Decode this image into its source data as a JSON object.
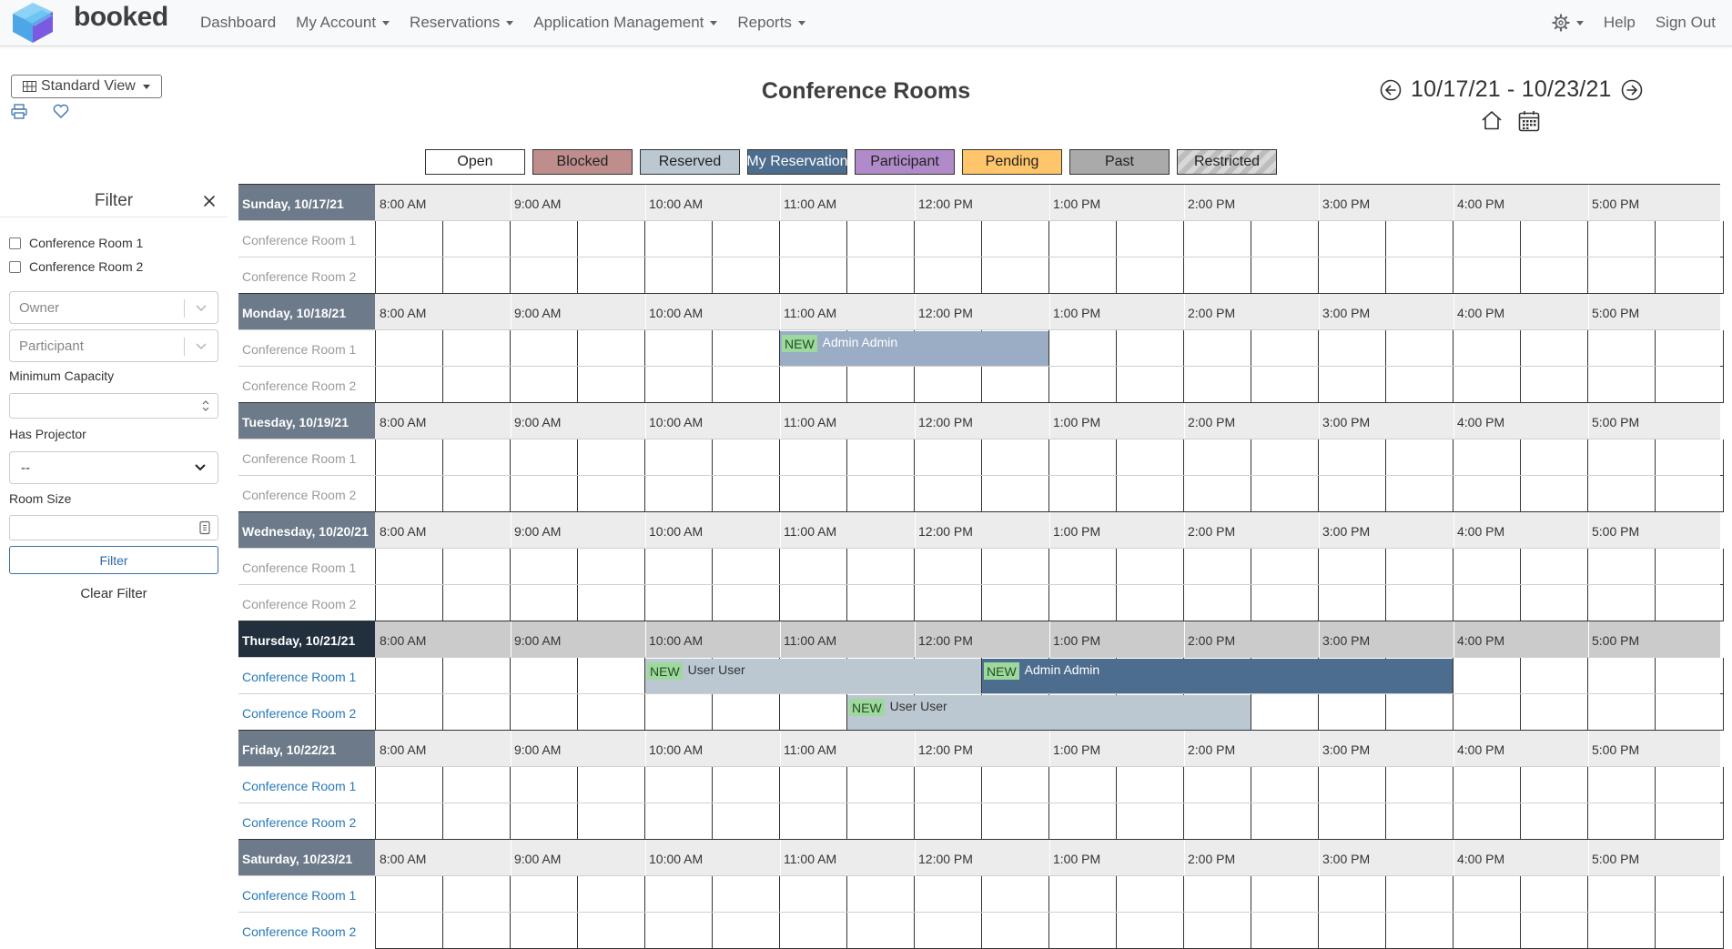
{
  "navbar": {
    "brand": "booked",
    "items": [
      "Dashboard",
      "My Account",
      "Reservations",
      "Application Management",
      "Reports"
    ],
    "right": [
      "Help",
      "Sign Out"
    ]
  },
  "toolbar": {
    "view_label": "Standard View",
    "title": "Conference Rooms",
    "date_range": "10/17/21 - 10/23/21"
  },
  "legend": [
    {
      "label": "Open",
      "bg": "#ffffff",
      "fg": "#222222"
    },
    {
      "label": "Blocked",
      "bg": "#c08d8d",
      "fg": "#222222"
    },
    {
      "label": "Reserved",
      "bg": "#bbc8d1",
      "fg": "#222222"
    },
    {
      "label": "My Reservation",
      "bg": "#4d6d8f",
      "fg": "#ffffff"
    },
    {
      "label": "Participant",
      "bg": "#b08ac9",
      "fg": "#222222"
    },
    {
      "label": "Pending",
      "bg": "#ffc56b",
      "fg": "#222222"
    },
    {
      "label": "Past",
      "bg": "#aaaaaa",
      "fg": "#222222"
    },
    {
      "label": "Restricted",
      "bg": "#cccccc",
      "fg": "#222222"
    }
  ],
  "filter": {
    "title": "Filter",
    "resources": [
      "Conference Room 1",
      "Conference Room 2"
    ],
    "owner_placeholder": "Owner",
    "participant_placeholder": "Participant",
    "min_capacity_label": "Minimum Capacity",
    "has_projector_label": "Has Projector",
    "has_projector_value": "--",
    "room_size_label": "Room Size",
    "filter_button": "Filter",
    "clear_button": "Clear Filter"
  },
  "schedule": {
    "times": [
      "8:00 AM",
      "9:00 AM",
      "10:00 AM",
      "11:00 AM",
      "12:00 PM",
      "1:00 PM",
      "2:00 PM",
      "3:00 PM",
      "4:00 PM",
      "5:00 PM"
    ],
    "resources": [
      "Conference Room 1",
      "Conference Room 2"
    ],
    "days": [
      {
        "label": "Sunday, 10/17/21",
        "today": false,
        "resource_links": false
      },
      {
        "label": "Monday, 10/18/21",
        "today": false,
        "resource_links": false
      },
      {
        "label": "Tuesday, 10/19/21",
        "today": false,
        "resource_links": false
      },
      {
        "label": "Wednesday, 10/20/21",
        "today": false,
        "resource_links": false
      },
      {
        "label": "Thursday, 10/21/21",
        "today": true,
        "resource_links": true
      },
      {
        "label": "Friday, 10/22/21",
        "today": false,
        "resource_links": true
      },
      {
        "label": "Saturday, 10/23/21",
        "today": false,
        "resource_links": true
      }
    ],
    "reservations": [
      {
        "day": 1,
        "resource": 0,
        "start": "11:00 AM",
        "end": "1:00 PM",
        "badge": "NEW",
        "user": "Admin Admin",
        "status": "past"
      },
      {
        "day": 4,
        "resource": 0,
        "start": "10:00 AM",
        "end": "12:30 PM",
        "badge": "NEW",
        "user": "User User",
        "status": "reserved"
      },
      {
        "day": 4,
        "resource": 0,
        "start": "12:30 PM",
        "end": "4:00 PM",
        "badge": "NEW",
        "user": "Admin Admin",
        "status": "mine"
      },
      {
        "day": 4,
        "resource": 1,
        "start": "11:30 AM",
        "end": "2:30 PM",
        "badge": "NEW",
        "user": "User User",
        "status": "reserved"
      }
    ],
    "status_colors": {
      "past": "#9aadc4",
      "reserved": "#bbc8d1",
      "mine": "#4d6d8f"
    }
  }
}
